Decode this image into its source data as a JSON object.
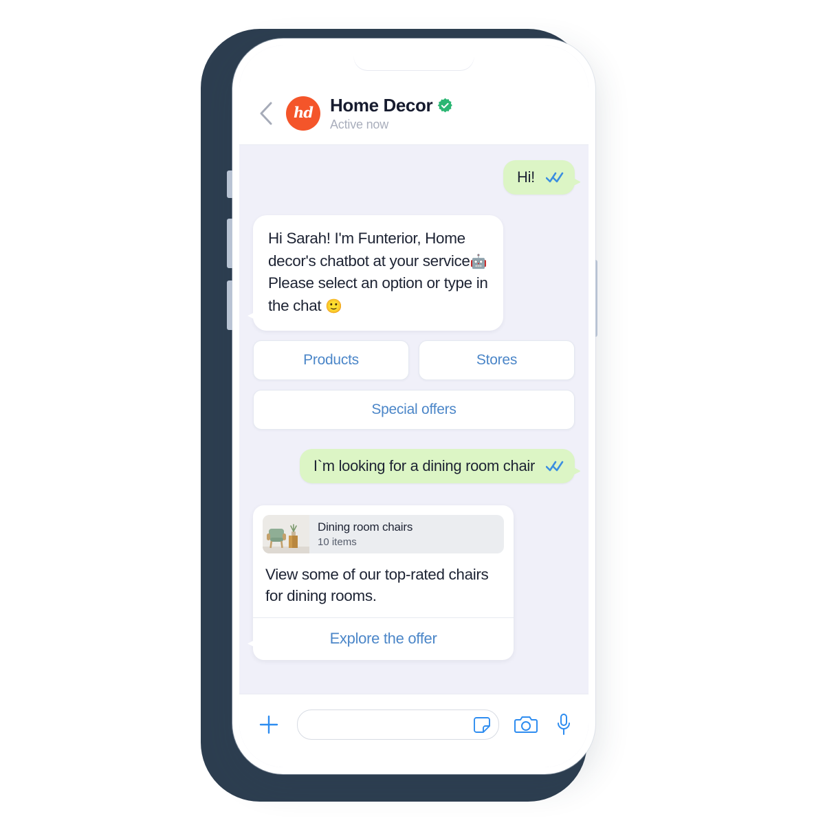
{
  "header": {
    "back_icon": "chevron-left-icon",
    "avatar_initials": "hd",
    "title": "Home Decor",
    "verified_icon": "verified-badge-icon",
    "status": "Active now"
  },
  "conversation": [
    {
      "id": "msg-hi",
      "direction": "outgoing",
      "text": "Hi!",
      "status_icon": "double-check-icon"
    },
    {
      "id": "msg-bot-intro",
      "direction": "incoming",
      "line1": "Hi Sarah! I'm Funterior, Home",
      "line2": "decor's chatbot at your service",
      "emoji1": "🤖",
      "line3": "Please select an option or type in",
      "line4": "the chat",
      "emoji2": "🙂"
    },
    {
      "id": "msg-user-request",
      "direction": "outgoing",
      "text": "I`m looking for a dining room chair",
      "status_icon": "double-check-icon"
    }
  ],
  "quick_replies": [
    {
      "id": "products",
      "label": "Products",
      "width": "half"
    },
    {
      "id": "stores",
      "label": "Stores",
      "width": "half"
    },
    {
      "id": "special-offers",
      "label": "Special offers",
      "width": "full"
    }
  ],
  "product_card": {
    "thumbnail_icon": "dining-chair-photo",
    "title": "Dining room chairs",
    "count": "10 items",
    "description": "View some of our top-rated chairs for dining rooms.",
    "cta": "Explore the offer"
  },
  "composer": {
    "plus_icon": "plus-icon",
    "input_value": "",
    "input_placeholder": "",
    "sticker_icon": "sticker-icon",
    "camera_icon": "camera-icon",
    "mic_icon": "microphone-icon"
  },
  "colors": {
    "brand_orange": "#f4552a",
    "verified_green": "#2bb673",
    "bubble_green": "#dcf5c5",
    "link_blue": "#4b86c8",
    "icon_blue": "#2d8cf0",
    "chat_bg": "#f0f0f9",
    "backdrop_navy": "#2d3e50"
  }
}
